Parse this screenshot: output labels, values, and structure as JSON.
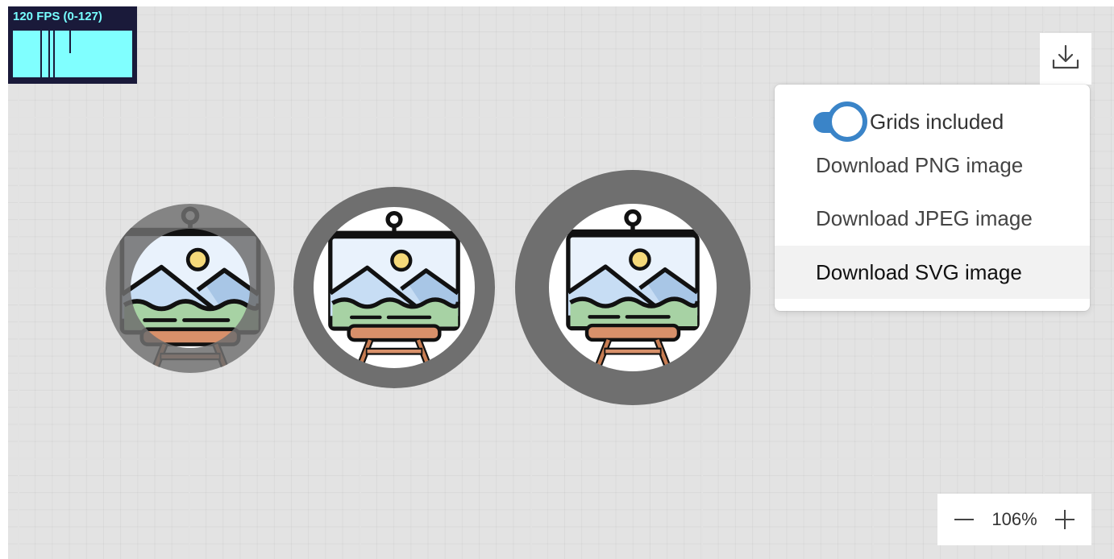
{
  "fps_meter": {
    "label": "120 FPS (0-127)"
  },
  "canvas": {
    "nodes": [
      {
        "name": "easel-node-1"
      },
      {
        "name": "easel-node-2"
      },
      {
        "name": "easel-node-3"
      }
    ]
  },
  "toolbar": {
    "download_icon": "download-icon"
  },
  "download_menu": {
    "toggle_label": "Grids included",
    "toggle_on": true,
    "items": [
      {
        "label": "Download PNG image"
      },
      {
        "label": "Download JPEG image"
      },
      {
        "label": "Download SVG image"
      }
    ],
    "accent": "#3a84c8"
  },
  "zoom": {
    "minus_icon": "minus-icon",
    "value": "106%",
    "plus_icon": "plus-icon"
  }
}
